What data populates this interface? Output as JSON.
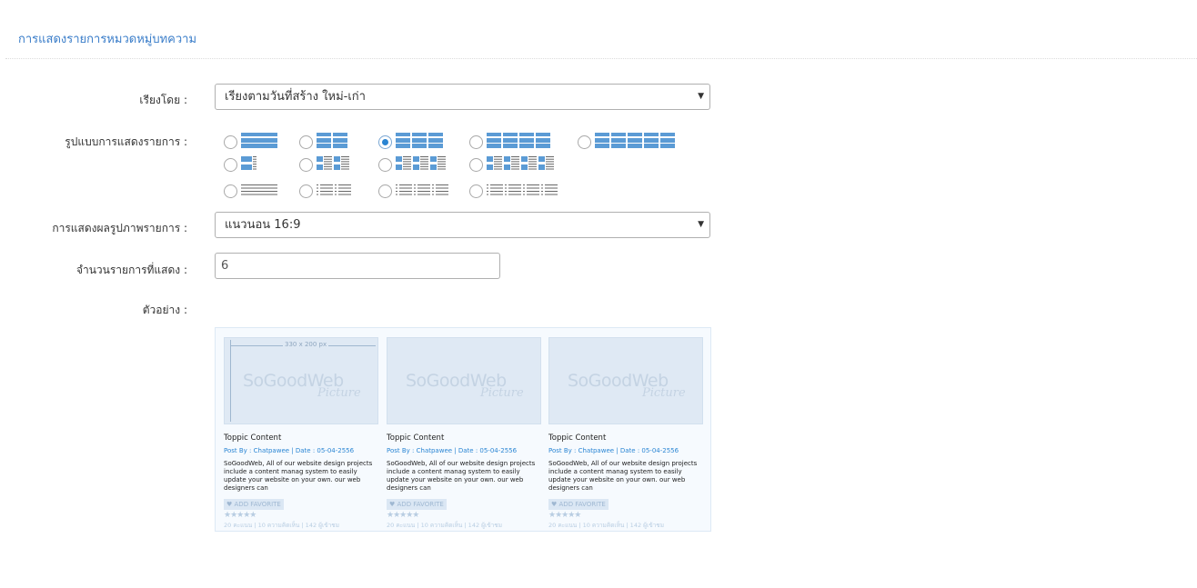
{
  "page": {
    "title": "การแสดงรายการหมวดหมู่บทความ"
  },
  "form": {
    "sort": {
      "label": "เรียงโดย :",
      "value": "เรียงตามวันที่สร้าง ใหม่-เก่า"
    },
    "layout": {
      "label": "รูปแบบการแสดงรายการ :",
      "selected_index": 2
    },
    "image_display": {
      "label": "การแสดงผลรูปภาพรายการ :",
      "value": "แนวนอน 16:9"
    },
    "count": {
      "label": "จำนวนรายการที่แสดง :",
      "value": "6"
    },
    "example": {
      "label": "ตัวอย่าง :"
    }
  },
  "preview": {
    "size_note": "330 x 200 px",
    "watermark": "SoGoodWeb",
    "watermark_sub": "Picture",
    "cards": [
      {
        "title": "Toppic Content",
        "meta": "Post By : Chatpawee  |  Date : 05-04-2556",
        "desc": "SoGoodWeb, All of our website design projects include a content manag system to easily update your website on your own. our web designers can",
        "fav": "ADD FAVORITE",
        "stars": "★★★★★",
        "stats": "20 คะแนน | 10 ความคิดเห็น | 142 ผู้เข้าชม"
      },
      {
        "title": "Toppic Content",
        "meta": "Post By : Chatpawee  |  Date : 05-04-2556",
        "desc": "SoGoodWeb, All of our website design projects include a content manag system to easily update your website on your own. our web designers can",
        "fav": "ADD FAVORITE",
        "stars": "★★★★★",
        "stats": "20 คะแนน | 10 ความคิดเห็น | 142 ผู้เข้าชม"
      },
      {
        "title": "Toppic Content",
        "meta": "Post By : Chatpawee  |  Date : 05-04-2556",
        "desc": "SoGoodWeb, All of our website design projects include a content manag system to easily update your website on your own. our web designers can",
        "fav": "ADD FAVORITE",
        "stars": "★★★★★",
        "stats": "20 คะแนน | 10 ความคิดเห็น | 142 ผู้เข้าชม"
      }
    ]
  },
  "colors": {
    "accent": "#3a7dc9",
    "layout_icon": "#5b9bd5"
  }
}
